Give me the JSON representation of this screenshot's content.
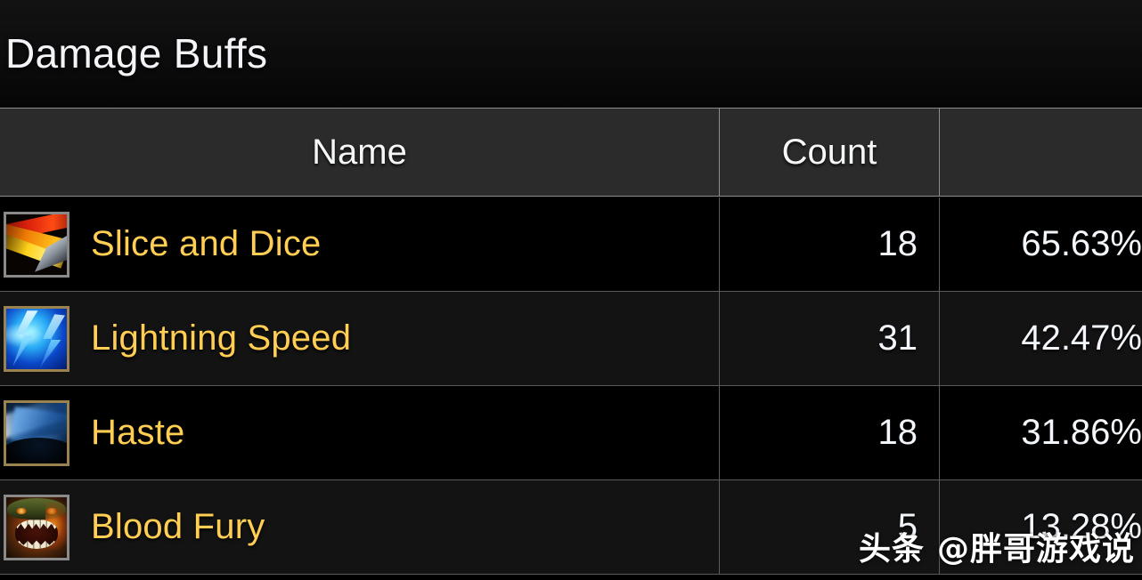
{
  "window": {
    "title": "Damage Buffs"
  },
  "table": {
    "columns": [
      {
        "key": "name",
        "label": "Name",
        "align": "center"
      },
      {
        "key": "count",
        "label": "Count",
        "align": "center"
      },
      {
        "key": "percent",
        "label": "",
        "align": "center"
      }
    ],
    "rows": [
      {
        "icon": "slice-and-dice-icon",
        "name": "Slice and Dice",
        "count": "18",
        "percent": "65.63%",
        "stripe": "dark"
      },
      {
        "icon": "lightning-speed-icon",
        "name": "Lightning Speed",
        "count": "31",
        "percent": "42.47%",
        "stripe": "light"
      },
      {
        "icon": "haste-icon",
        "name": "Haste",
        "count": "18",
        "percent": "31.86%",
        "stripe": "dark"
      },
      {
        "icon": "blood-fury-icon",
        "name": "Blood Fury",
        "count": "5",
        "percent": "13.28%",
        "stripe": "light"
      }
    ]
  },
  "watermark": {
    "logo_text": "头条",
    "handle": "@胖哥游戏说"
  },
  "colors": {
    "title_text": "#f2f4f7",
    "header_text": "#f4f6f8",
    "header_bg": "#2b2b2b",
    "spell_name": "#ffce52",
    "number_text": "#f3f6fa",
    "row_dark": "#000000",
    "row_light": "#131313",
    "grid_line": "#5c5c5c"
  }
}
